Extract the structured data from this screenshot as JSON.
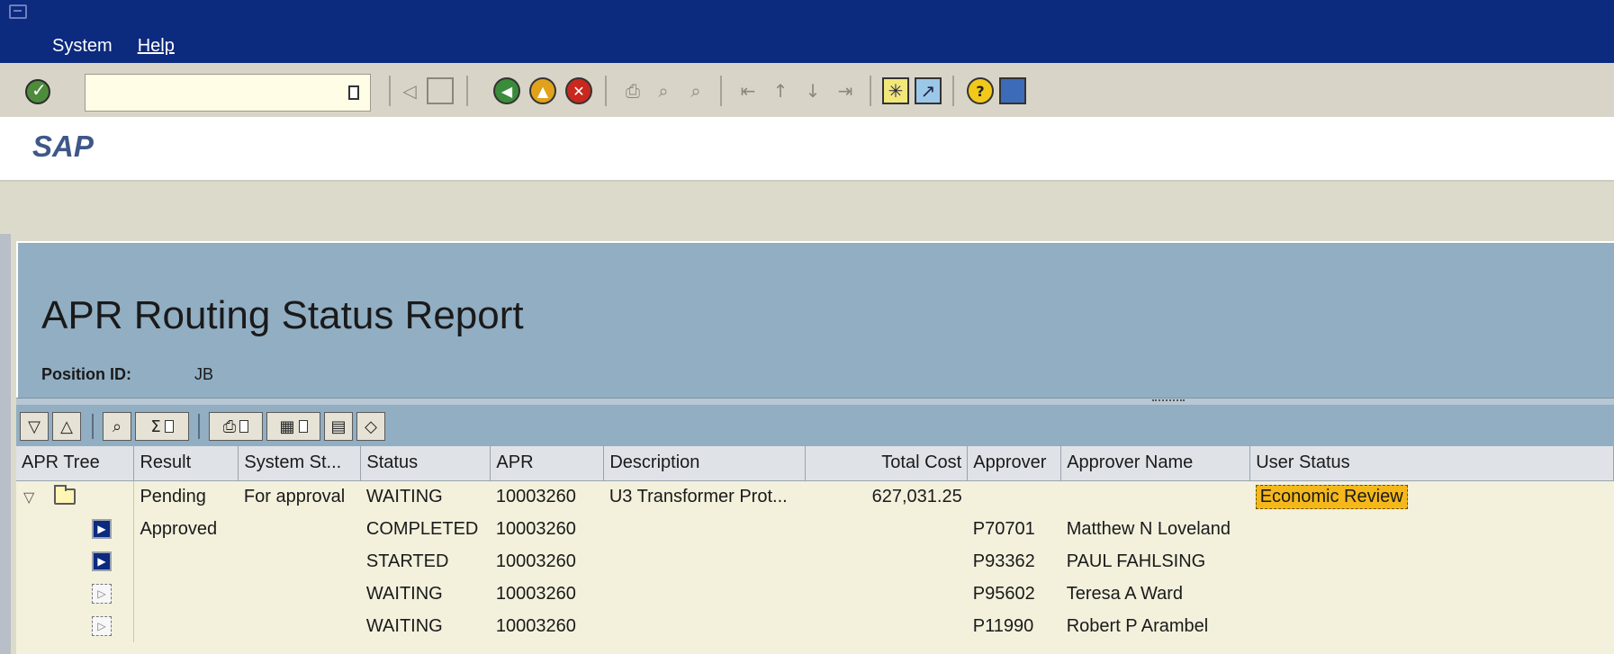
{
  "menu": {
    "items": [
      {
        "label": "System",
        "hotkey": "y"
      },
      {
        "label": "Help",
        "hotkey": "H"
      }
    ]
  },
  "toolbar": {
    "command_value": "",
    "icons": [
      "enter-icon",
      "history-dropdown-icon",
      "back-arrow-icon",
      "save-icon",
      "back-icon",
      "exit-icon",
      "cancel-icon",
      "print-icon",
      "find-icon",
      "find-next-icon",
      "first-page-icon",
      "previous-page-icon",
      "next-page-icon",
      "last-page-icon",
      "create-session-icon",
      "create-shortcut-icon",
      "help-icon",
      "layout-menu-icon"
    ]
  },
  "header": {
    "logo": "SAP"
  },
  "report": {
    "title": "APR Routing Status Report",
    "position_label": "Position ID:",
    "position_value": "JB"
  },
  "grid": {
    "columns": [
      "APR Tree",
      "Result",
      "System St...",
      "Status",
      "APR",
      "Description",
      "Total Cost",
      "Approver",
      "Approver Name",
      "User Status"
    ],
    "rows": [
      {
        "result": "Pending",
        "system_status": "For approval",
        "status": "WAITING",
        "apr": "10003260",
        "description": "U3 Transformer Prot...",
        "total_cost": "627,031.25",
        "approver": "",
        "approver_name": "",
        "user_status": "Economic Review"
      },
      {
        "result": "Approved",
        "system_status": "",
        "status": "COMPLETED",
        "apr": "10003260",
        "description": "",
        "total_cost": "",
        "approver": "P70701",
        "approver_name": "Matthew N Loveland",
        "user_status": ""
      },
      {
        "result": "",
        "system_status": "",
        "status": "STARTED",
        "apr": "10003260",
        "description": "",
        "total_cost": "",
        "approver": "P93362",
        "approver_name": "PAUL FAHLSING",
        "user_status": ""
      },
      {
        "result": "",
        "system_status": "",
        "status": "WAITING",
        "apr": "10003260",
        "description": "",
        "total_cost": "",
        "approver": "P95602",
        "approver_name": "Teresa A Ward",
        "user_status": ""
      },
      {
        "result": "",
        "system_status": "",
        "status": "WAITING",
        "apr": "10003260",
        "description": "",
        "total_cost": "",
        "approver": "P11990",
        "approver_name": "Robert P Arambel",
        "user_status": ""
      }
    ]
  },
  "colors": {
    "title_bar": "#0c2a7e",
    "header_panel": "#91aec3",
    "user_status_highlight": "#f5b81a"
  }
}
